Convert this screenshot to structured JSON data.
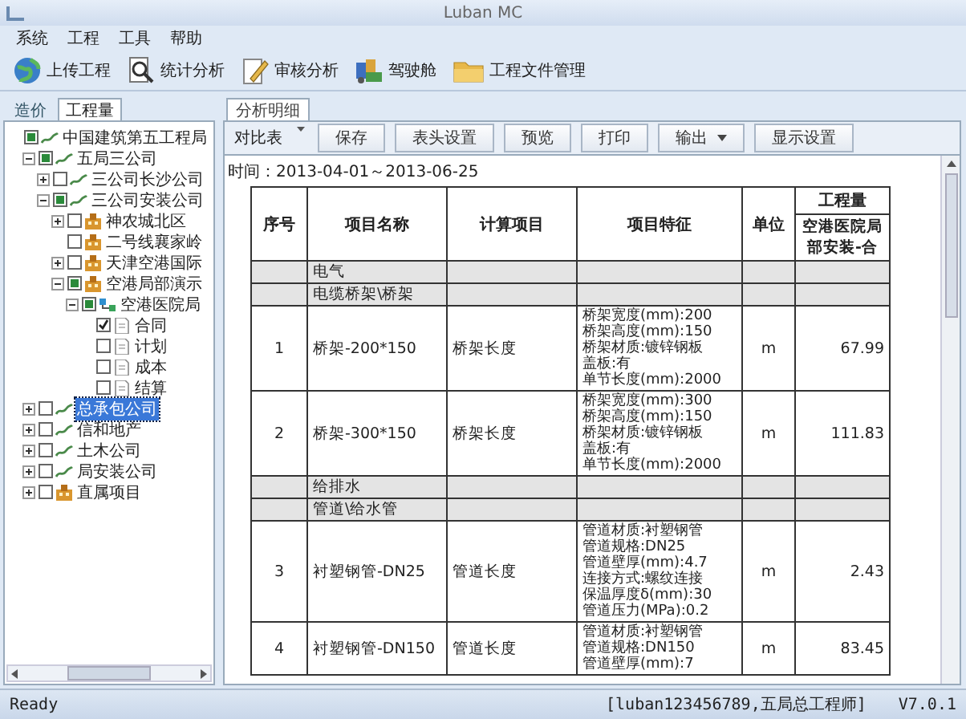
{
  "window": {
    "title": "Luban MC"
  },
  "menu": [
    "系统",
    "工程",
    "工具",
    "帮助"
  ],
  "toolbar": [
    {
      "label": "上传工程"
    },
    {
      "label": "统计分析"
    },
    {
      "label": "审核分析"
    },
    {
      "label": "驾驶舱"
    },
    {
      "label": "工程文件管理"
    }
  ],
  "side_tabs": [
    {
      "label": "造价",
      "selected": false
    },
    {
      "label": "工程量",
      "selected": true
    }
  ],
  "tree": [
    {
      "label": "中国建筑第五工程局",
      "kind": "org",
      "checked": false,
      "partial": true,
      "selected": false,
      "children": [
        {
          "label": "五局三公司",
          "kind": "org",
          "checked": false,
          "partial": true,
          "expanded": true,
          "selected": false,
          "children": [
            {
              "label": "三公司长沙公司",
              "kind": "org",
              "checked": false,
              "partial": false,
              "expanded": false,
              "selected": false
            },
            {
              "label": "三公司安装公司",
              "kind": "org",
              "checked": false,
              "partial": true,
              "expanded": true,
              "selected": false,
              "children": [
                {
                  "label": "神农城北区",
                  "kind": "site",
                  "checked": false,
                  "partial": false,
                  "expanded": false,
                  "selected": false
                },
                {
                  "label": "二号线襄家岭",
                  "kind": "site",
                  "checked": false,
                  "partial": false,
                  "selected": false
                },
                {
                  "label": "天津空港国际",
                  "kind": "site",
                  "checked": false,
                  "partial": false,
                  "expanded": false,
                  "selected": false
                },
                {
                  "label": "空港局部演示",
                  "kind": "site",
                  "checked": false,
                  "partial": true,
                  "expanded": true,
                  "selected": false,
                  "children": [
                    {
                      "label": "空港医院局",
                      "kind": "unit",
                      "checked": false,
                      "partial": true,
                      "expanded": true,
                      "selected": false,
                      "children": [
                        {
                          "label": "合同",
                          "kind": "doc",
                          "checked": true,
                          "partial": false,
                          "selected": false
                        },
                        {
                          "label": "计划",
                          "kind": "doc",
                          "checked": false,
                          "partial": false,
                          "selected": false
                        },
                        {
                          "label": "成本",
                          "kind": "doc",
                          "checked": false,
                          "partial": false,
                          "selected": false
                        },
                        {
                          "label": "结算",
                          "kind": "doc",
                          "checked": false,
                          "partial": false,
                          "selected": false
                        }
                      ]
                    }
                  ]
                }
              ]
            }
          ]
        },
        {
          "label": "总承包公司",
          "kind": "org",
          "checked": false,
          "partial": false,
          "expanded": false,
          "selected": true
        },
        {
          "label": "信和地产",
          "kind": "org",
          "checked": false,
          "partial": false,
          "expanded": false,
          "selected": false
        },
        {
          "label": "土木公司",
          "kind": "org",
          "checked": false,
          "partial": false,
          "expanded": false,
          "selected": false
        },
        {
          "label": "局安装公司",
          "kind": "org",
          "checked": false,
          "partial": false,
          "expanded": false,
          "selected": false
        },
        {
          "label": "直属项目",
          "kind": "site",
          "checked": false,
          "partial": false,
          "expanded": false,
          "selected": false
        }
      ]
    }
  ],
  "main_tabs": [
    {
      "label": "分析明细",
      "selected": true
    }
  ],
  "report_controls": {
    "view_select": "对比表",
    "buttons": [
      {
        "label": "保存",
        "dropdown": false
      },
      {
        "label": "表头设置",
        "dropdown": false
      },
      {
        "label": "预览",
        "dropdown": false
      },
      {
        "label": "打印",
        "dropdown": false
      },
      {
        "label": "输出",
        "dropdown": true
      },
      {
        "label": "显示设置",
        "dropdown": false
      }
    ]
  },
  "report": {
    "time": "时间：2013-04-01～2013-06-25",
    "columns": [
      "序号",
      "项目名称",
      "计算项目",
      "项目特征",
      "单位"
    ],
    "quantity_header": "工程量",
    "quantity_subheader": "空港医院局部安装-合",
    "rows": [
      {
        "kind": "group",
        "name": "电气"
      },
      {
        "kind": "group",
        "name": "电缆桥架\\桥架"
      },
      {
        "kind": "item",
        "seq": "1",
        "name": "桥架-200*150",
        "calc": "桥架长度",
        "features": [
          "桥架宽度(mm):200",
          "桥架高度(mm):150",
          "桥架材质:镀锌钢板",
          "盖板:有",
          "单节长度(mm):2000"
        ],
        "unit": "m",
        "qty": "67.99"
      },
      {
        "kind": "item",
        "seq": "2",
        "name": "桥架-300*150",
        "calc": "桥架长度",
        "features": [
          "桥架宽度(mm):300",
          "桥架高度(mm):150",
          "桥架材质:镀锌钢板",
          "盖板:有",
          "单节长度(mm):2000"
        ],
        "unit": "m",
        "qty": "111.83"
      },
      {
        "kind": "group",
        "name": "给排水"
      },
      {
        "kind": "group",
        "name": "管道\\给水管"
      },
      {
        "kind": "item",
        "seq": "3",
        "name": "衬塑钢管-DN25",
        "calc": "管道长度",
        "features": [
          "管道材质:衬塑钢管",
          "管道规格:DN25",
          "管道壁厚(mm):4.7",
          "连接方式:螺纹连接",
          "保温厚度δ(mm):30",
          "管道压力(MPa):0.2"
        ],
        "unit": "m",
        "qty": "2.43"
      },
      {
        "kind": "item",
        "seq": "4",
        "name": "衬塑钢管-DN150",
        "calc": "管道长度",
        "features": [
          "管道材质:衬塑钢管",
          "管道规格:DN150",
          "管道壁厚(mm):7"
        ],
        "unit": "m",
        "qty": "83.45"
      }
    ]
  },
  "status_bar": {
    "message": "Ready",
    "user": "[luban123456789,五局总工程师]",
    "version": "V7.0.1"
  }
}
